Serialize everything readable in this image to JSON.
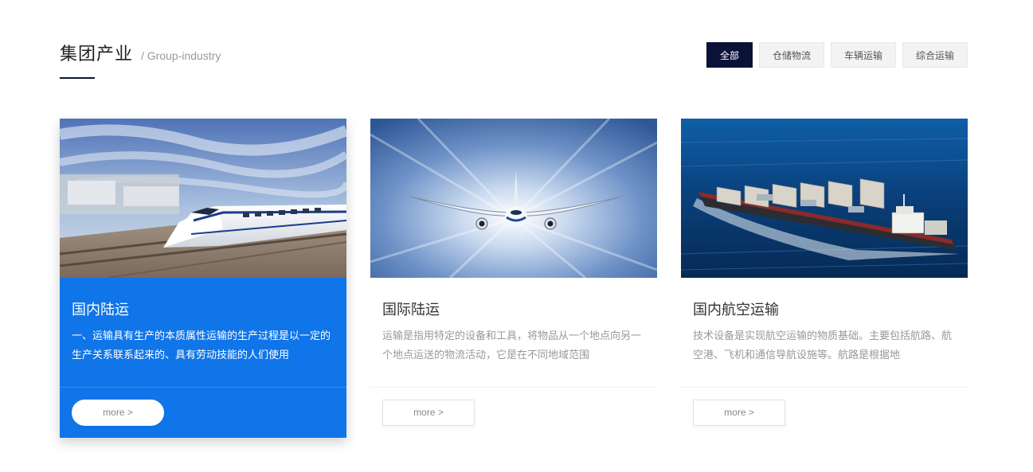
{
  "section": {
    "title": "集团产业",
    "subtitle": "/ Group-industry"
  },
  "filters": [
    {
      "label": "全部",
      "active": true
    },
    {
      "label": "仓储物流",
      "active": false
    },
    {
      "label": "车辆运输",
      "active": false
    },
    {
      "label": "综合运输",
      "active": false
    }
  ],
  "cards": [
    {
      "title": "国内陆运",
      "desc": "一、运输具有生产的本质属性运输的生产过程是以一定的生产关系联系起来的、具有劳动技能的人们使用",
      "more": "more >",
      "image": "high-speed-train-photo",
      "active": true
    },
    {
      "title": "国际陆运",
      "desc": "运输是指用特定的设备和工具，将物品从一个地点向另一个地点运送的物流活动，它是在不同地域范围",
      "more": "more >",
      "image": "airplane-photo",
      "active": false
    },
    {
      "title": "国内航空运输",
      "desc": "技术设备是实现航空运输的物质基础。主要包括航路、航空港、飞机和通信导航设施等。航路是根据地",
      "more": "more >",
      "image": "cargo-ship-photo",
      "active": false
    }
  ],
  "colors": {
    "active_card": "#1075e8",
    "active_tab": "#0b1238"
  }
}
